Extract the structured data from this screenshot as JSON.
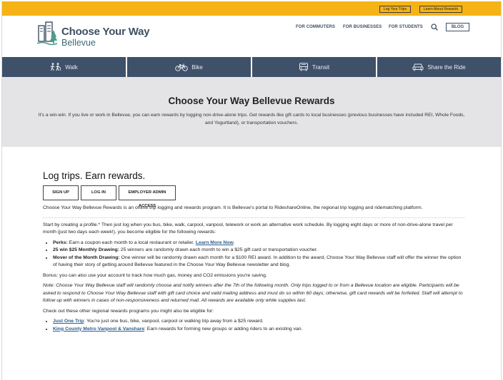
{
  "topbar": {
    "log_trips": "Log Your Trips",
    "learn_rewards": "Learn About Rewards"
  },
  "header": {
    "logo_line1": "Choose Your Way",
    "logo_line2": "Bellevue",
    "nav": [
      "FOR COMMUTERS",
      "FOR BUSINESSES",
      "FOR STUDENTS"
    ],
    "blog": "BLOG"
  },
  "modes": [
    {
      "label": "Walk",
      "icon": "walk-icon"
    },
    {
      "label": "Bike",
      "icon": "bike-icon"
    },
    {
      "label": "Transit",
      "icon": "bus-icon"
    },
    {
      "label": "Share the Ride",
      "icon": "car-icon"
    }
  ],
  "hero": {
    "title": "Choose Your Way Bellevue Rewards",
    "text": "It's a win-win. If you live or work in Bellevue, you can earn rewards by logging non-drive-alone trips. Get rewards like gift cards to local businesses (previous businesses have included REI, Whole Foods, and Yogurtland), or transportation vouchers."
  },
  "main": {
    "heading": "Log trips. Earn rewards.",
    "buttons": [
      "SIGN UP",
      "LOG IN",
      "EMPLOYER ADMIN ACCESS"
    ],
    "intro": "Choose Your Way Bellevue Rewards is an online trip logging and rewards program. It is Bellevue's portal to RideshareOnline, the regional trip logging and ridematching platform.",
    "start": "Start by creating a profile.* Then just log when you bus, bike, walk, carpool, vanpool, telework or work an alternative work schedule. By logging eight days or more of non-drive-alone travel per month (just two days each week!), you become eligible for the following rewards:",
    "rewards": [
      {
        "bold": "Perks:",
        "text": " Earn a coupon each month to a local restaurant or retailer. ",
        "link": "Learn More Now",
        "after": "."
      },
      {
        "bold": "25 win $25 Monthly Drawing:",
        "text": " 25 winners are randomly drawn each month to win a $25 gift card or transportation voucher.",
        "link": "",
        "after": ""
      },
      {
        "bold": "Mover of the Month Drawing:",
        "text": " One winner will be randomly drawn each month for a $100 REI award. In addition to the award, Choose Your Way Bellevue staff will offer the winner the option of having their story of getting around Bellevue featured in the Choose Your Way Bellevue newsletter and blog.",
        "link": "",
        "after": ""
      }
    ],
    "bonus": "Bonus: you can also use your account to track how much gas, money and CO2 emissions you're saving.",
    "note": "Note: Choose Your Way Bellevue staff will randomly choose and notify winners after the 7th of the following month. Only trips logged to or from a Bellevue location are eligible. Participants will be asked to respond to Choose Your Way Bellevue staff with gift card choice and valid mailing address and must do so within 60 days; otherwise, gift card rewards will be forfeited. Staff will attempt to follow up with winners in cases of non-responsiveness and returned mail. All rewards are available only while supplies last.",
    "other": "Check out these other regional rewards programs you might also be eligible for:",
    "programs": [
      {
        "link": "Just One Trip",
        "text": ": You're just one bus, bike, vanpool, carpool or walking trip away from a $25 reward."
      },
      {
        "link": "King County Metro Vanpool & Vanshare",
        "text": ": Earn rewards for forming new groups or adding riders to an existing van."
      }
    ]
  },
  "colors": {
    "topbar": "#f5b316",
    "navy": "#3f5069",
    "hero_bg": "#e4e4e6",
    "link": "#2a5d8f"
  }
}
